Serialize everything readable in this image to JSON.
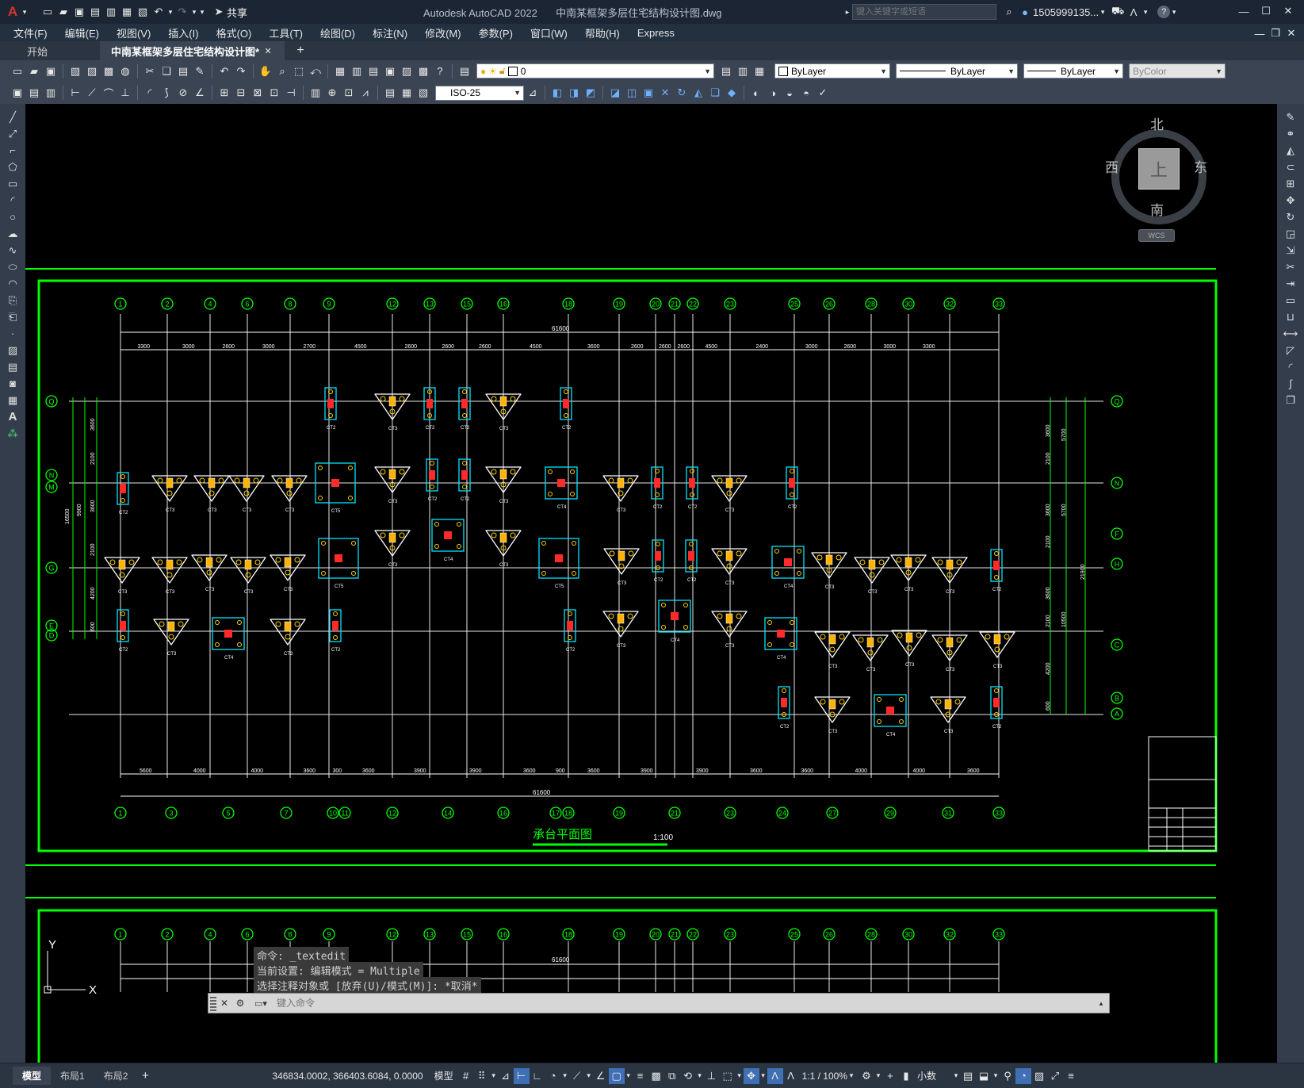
{
  "titlebar": {
    "app_title": "Autodesk AutoCAD 2022",
    "file_title": "中南某框架多层住宅结构设计图.dwg",
    "share_label": "共享",
    "search_placeholder": "键入关键字或短语",
    "user": "1505999135...",
    "colors": {
      "bg": "#1b2533",
      "accent": "#d9342b"
    }
  },
  "menu": [
    "文件(F)",
    "编辑(E)",
    "视图(V)",
    "插入(I)",
    "格式(O)",
    "工具(T)",
    "绘图(D)",
    "标注(N)",
    "修改(M)",
    "参数(P)",
    "窗口(W)",
    "帮助(H)",
    "Express"
  ],
  "tabs": {
    "start": "开始",
    "drawing": "中南某框架多层住宅结构设计图*"
  },
  "toolbar": {
    "layer_value": "0",
    "color_value": "ByLayer",
    "linetype_value": "ByLayer",
    "lineweight_value": "ByLayer",
    "plotstyle_value": "ByColor",
    "dimstyle_value": "ISO-25"
  },
  "viewcube": {
    "north": "北",
    "south": "南",
    "east": "东",
    "west": "西",
    "face": "上",
    "wcs": "WCS"
  },
  "drawing": {
    "title": "承台平面图",
    "scale": "1:100",
    "top_axes": [
      "1",
      "2",
      "4",
      "6",
      "8",
      "9",
      "12",
      "13",
      "15",
      "16",
      "18",
      "19",
      "20",
      "21",
      "22",
      "23",
      "25",
      "26",
      "28",
      "30",
      "32",
      "33"
    ],
    "bottom_axes": [
      "1",
      "3",
      "5",
      "7",
      "10",
      "11",
      "12",
      "14",
      "16",
      "17",
      "18",
      "19",
      "21",
      "23",
      "24",
      "27",
      "29",
      "31",
      "33"
    ],
    "left_axes": [
      "Q",
      "N",
      "M",
      "G",
      "E",
      "D"
    ],
    "right_axes": [
      "Q",
      "N",
      "F",
      "H",
      "C",
      "B",
      "A"
    ],
    "total_dim": "61600",
    "top_dims": [
      "3300",
      "3000",
      "2600",
      "3000",
      "2700",
      "4500",
      "2600",
      "2600",
      "2600",
      "4500",
      "3600",
      "2600",
      "2600",
      "2600",
      "4500",
      "2400",
      "3000",
      "2600",
      "3000",
      "3300"
    ],
    "bottom_dims": [
      "5600",
      "4000",
      "4000",
      "3600",
      "300",
      "3600",
      "3900",
      "3900",
      "3600",
      "900",
      "3600",
      "3900",
      "3900",
      "3600",
      "3600",
      "4000",
      "4000",
      "3600"
    ],
    "left_dims": [
      "3600",
      "2100",
      "3600",
      "2100",
      "4200",
      "600",
      "9900",
      "16500"
    ],
    "right_dims": [
      "3600",
      "2100",
      "3600",
      "2100",
      "3600",
      "2100",
      "4200",
      "600",
      "5700",
      "5700",
      "10500",
      "21900"
    ],
    "cap_labels": [
      "CT1",
      "CT2",
      "CT3",
      "CT4",
      "CT5"
    ],
    "colors": {
      "grid": "#e8e8e8",
      "axis_bubble": "#00ff00",
      "cap_outline": "#00e5ff",
      "column": "#ff2a2a",
      "cap_shape": "#ffffff",
      "frame": "#00ff00",
      "dim": "#ffffff"
    }
  },
  "command": {
    "line1": "命令: _textedit",
    "line2": "当前设置: 编辑模式 = Multiple",
    "line3": "选择注释对象或 [放弃(U)/模式(M)]: *取消*",
    "placeholder": "键入命令"
  },
  "status": {
    "layout_tabs": [
      "模型",
      "布局1",
      "布局2"
    ],
    "coords": "346834.0002, 366403.6084, 0.0000",
    "space": "模型",
    "scale": "1:1 / 100%",
    "units": "小数"
  }
}
